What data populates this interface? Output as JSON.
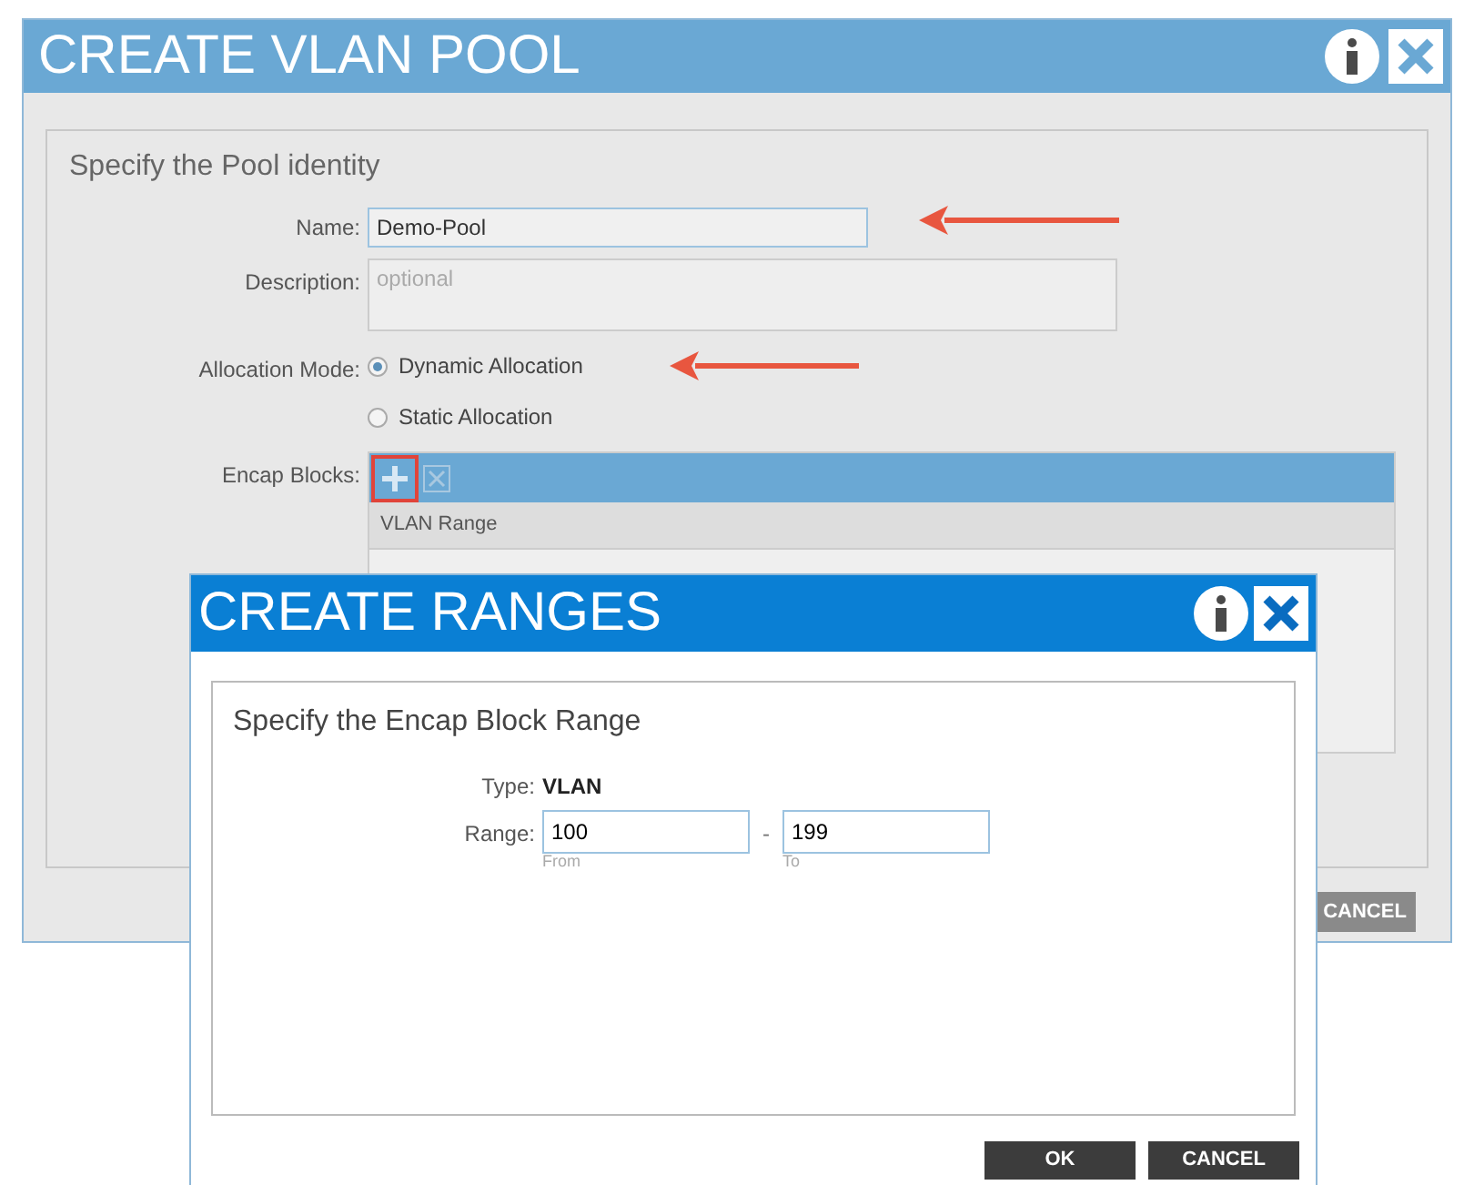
{
  "dialog": {
    "title": "CREATE VLAN POOL",
    "section_title": "Specify the Pool identity",
    "name_label": "Name:",
    "name_value": "Demo-Pool",
    "description_label": "Description:",
    "description_placeholder": "optional",
    "allocation_label": "Allocation Mode:",
    "allocation_options": [
      {
        "label": "Dynamic Allocation",
        "selected": true
      },
      {
        "label": "Static Allocation",
        "selected": false
      }
    ],
    "encap_label": "Encap Blocks:",
    "table_columns": [
      "VLAN Range"
    ],
    "cancel_button": "CANCEL"
  },
  "subdialog": {
    "title": "CREATE RANGES",
    "section_title": "Specify the Encap Block Range",
    "type_label": "Type:",
    "type_value": "VLAN",
    "range_label": "Range:",
    "from_value": "100",
    "from_caption": "From",
    "separator": "-",
    "to_value": "199",
    "to_caption": "To",
    "buttons": [
      "OK",
      "CANCEL"
    ]
  }
}
